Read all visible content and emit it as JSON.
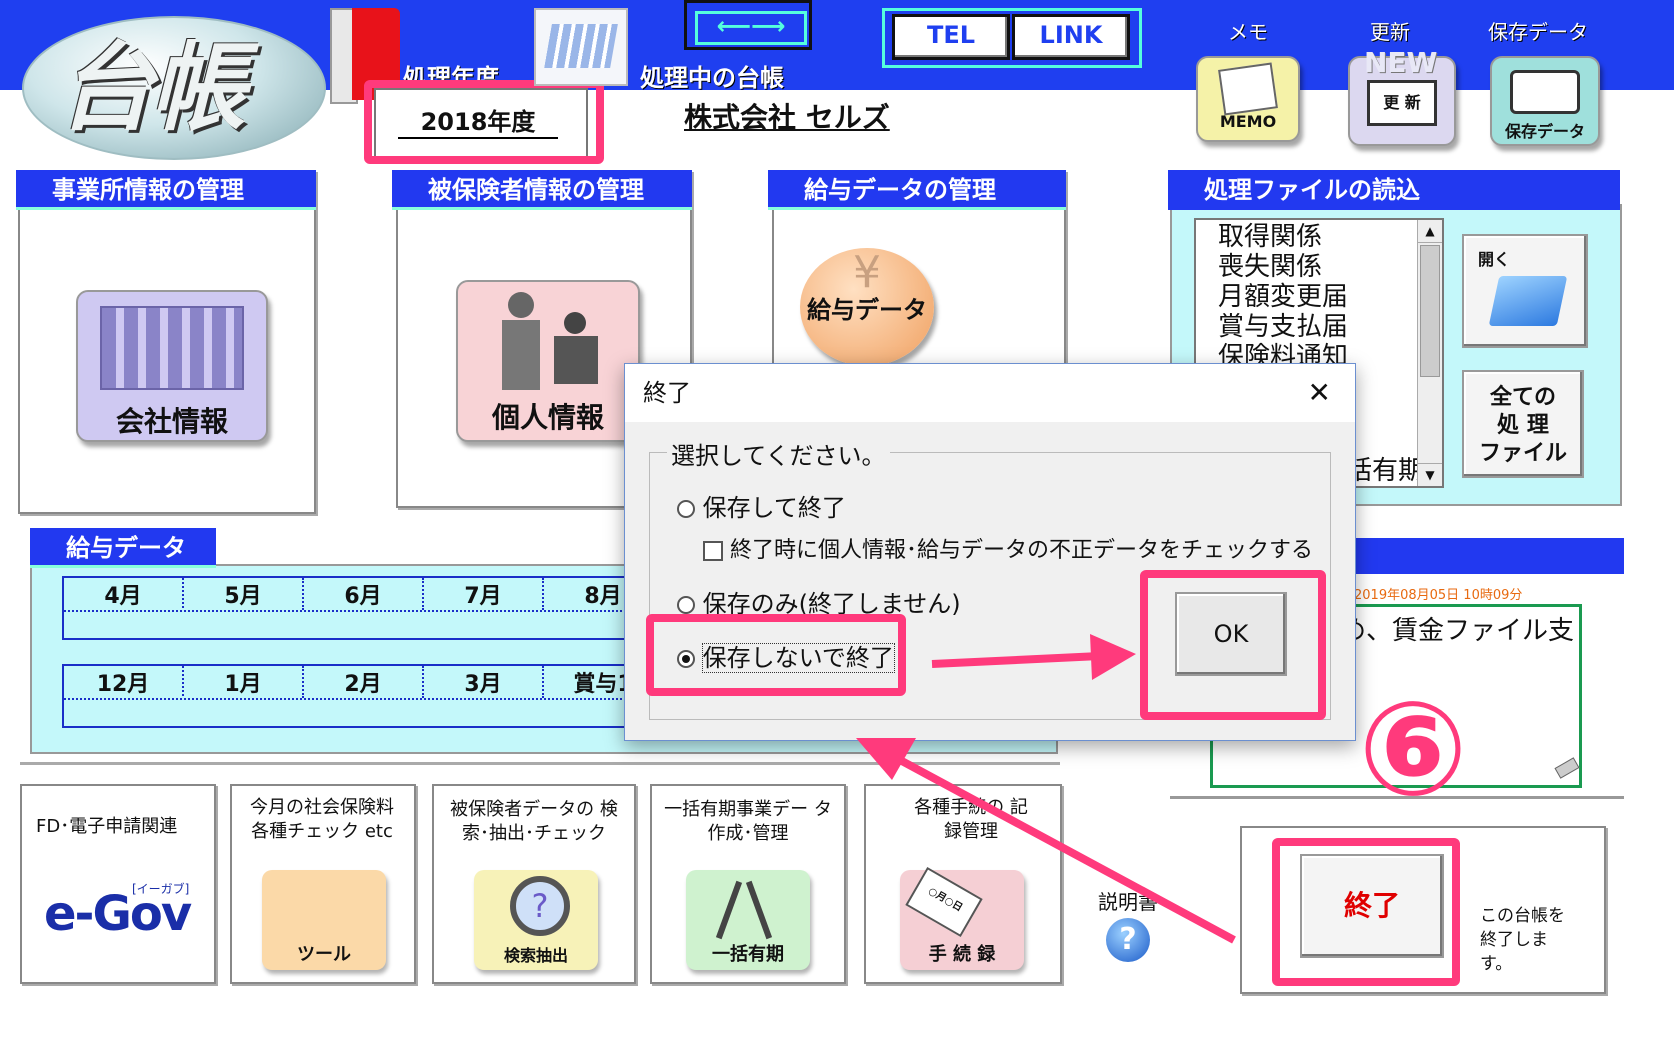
{
  "header": {
    "logo_text": "台帳",
    "fiscal_year_label": "処理年度",
    "fiscal_year_value": "2018年度",
    "current_ledger_label": "処理中の台帳",
    "company_name": "株式会社 セルズ",
    "tel_button": "TEL",
    "link_button": "LINK",
    "memo_label": "メモ",
    "memo_icon_text": "MEMO",
    "update_label": "更新",
    "update_icon_top": "NEW",
    "update_icon_text": "更 新",
    "saved_data_label": "保存データ",
    "saved_data_icon_text": "保存データ"
  },
  "panels": {
    "office": {
      "title": "事業所情報の管理",
      "button": "会社情報"
    },
    "insured": {
      "title": "被保険者情報の管理",
      "button": "個人情報"
    },
    "salary": {
      "title": "給与データの管理",
      "button": "給与データ"
    },
    "files": {
      "title": "処理ファイルの読込",
      "items": [
        "取得関係",
        "喪失関係",
        "月額変更届",
        "賞与支払届",
        "保険料通知"
      ],
      "partial_item": "括有期",
      "ok_button": "開く",
      "all_files_button": [
        "全ての",
        "処 理",
        "ファイル"
      ]
    }
  },
  "salary_data": {
    "title": "給与データ",
    "row1": [
      "4月",
      "5月",
      "6月",
      "7月",
      "8月"
    ],
    "row2": [
      "12月",
      "1月",
      "2月",
      "3月",
      "賞与1"
    ]
  },
  "memo_box": {
    "timestamp": "2019年08月05日 10時09分",
    "text": "め、賃金ファイル支"
  },
  "bottom_tiles": [
    {
      "title": "FD･電子申請関連",
      "icon": "e-Gov",
      "icon_sub": "[イーガブ]"
    },
    {
      "title": "今月の社会保険料 各種チェック etc",
      "icon": "ツール"
    },
    {
      "title": "被保険者データの 検索･抽出･チェック",
      "icon": "検索抽出"
    },
    {
      "title": "一括有期事業デー タ作成･管理",
      "icon": "一括有期"
    },
    {
      "title": "各種手続の 記録管理",
      "icon": "手 続 録",
      "card_text": "○月○日"
    }
  ],
  "help": {
    "label": "説明書",
    "icon": "?"
  },
  "exit_panel": {
    "button": "終了",
    "description": "この台帳を 終了します。"
  },
  "dialog": {
    "title": "終了",
    "close": "✕",
    "group_label": "選択してください。",
    "option1": "保存して終了",
    "checkbox": "終了時に個人情報･給与データの不正データをチェックする",
    "option2": "保存のみ(終了しません)",
    "option3": "保存しないで終了",
    "ok": "OK"
  },
  "annotation": {
    "step": "⑥"
  },
  "colors": {
    "topbar": "#1f3ff0",
    "panel_header": "#2239f0",
    "highlight": "#ff3a7c",
    "cyan": "#c4f8fa"
  }
}
